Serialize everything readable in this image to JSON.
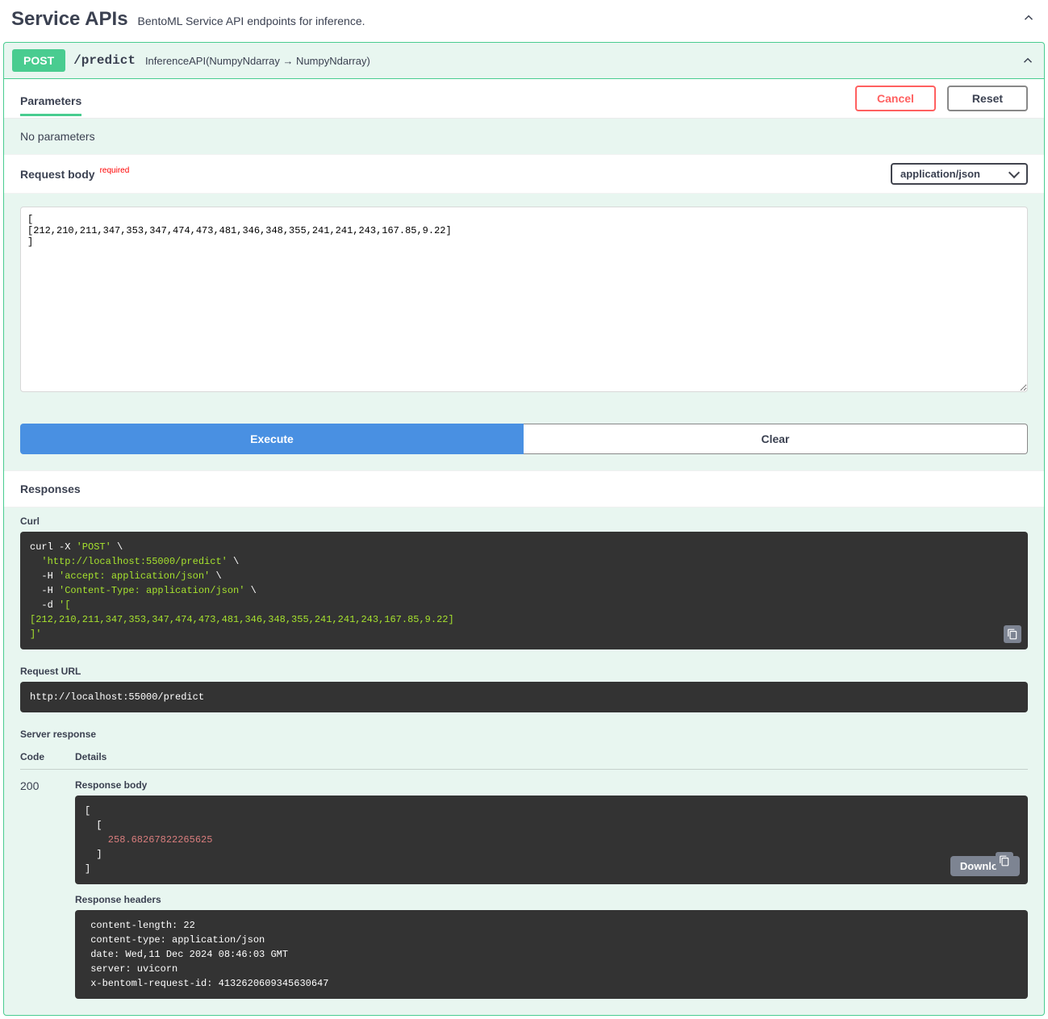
{
  "section": {
    "title": "Service APIs",
    "description": "BentoML Service API endpoints for inference."
  },
  "op": {
    "method": "POST",
    "path": "/predict",
    "description": "InferenceAPI(NumpyNdarray → NumpyNdarray)"
  },
  "tabs": {
    "parameters": "Parameters",
    "cancel": "Cancel",
    "reset": "Reset"
  },
  "params": {
    "empty": "No parameters"
  },
  "request": {
    "label": "Request body",
    "required": "required",
    "contentType": "application/json",
    "body": "[\n[212,210,211,347,353,347,474,473,481,346,348,355,241,241,243,167.85,9.22]\n]"
  },
  "buttons": {
    "execute": "Execute",
    "clear": "Clear",
    "download": "Download"
  },
  "responsesHeader": "Responses",
  "curl": {
    "label": "Curl",
    "l1a": "curl -X ",
    "l1b": "'POST'",
    "l1c": " \\",
    "l2": "  'http://localhost:55000/predict'",
    "l2c": " \\",
    "l3a": "  -H ",
    "l3b": "'accept: application/json'",
    "l3c": " \\",
    "l4a": "  -H ",
    "l4b": "'Content-Type: application/json'",
    "l4c": " \\",
    "l5a": "  -d ",
    "l5b": "'[",
    "l6": "[212,210,211,347,353,347,474,473,481,346,348,355,241,241,243,167.85,9.22]",
    "l7": "]'"
  },
  "requestUrl": {
    "label": "Request URL",
    "value": "http://localhost:55000/predict"
  },
  "server": {
    "label": "Server response",
    "codeHeader": "Code",
    "detailsHeader": "Details",
    "code": "200",
    "responseBodyLabel": "Response body",
    "body": {
      "l1": "[",
      "l2": "  [",
      "l3": "    258.68267822265625",
      "l4": "  ]",
      "l5": "]"
    },
    "responseHeadersLabel": "Response headers",
    "headers": " content-length: 22 \n content-type: application/json \n date: Wed,11 Dec 2024 08:46:03 GMT \n server: uvicorn \n x-bentoml-request-id: 4132620609345630647 "
  }
}
